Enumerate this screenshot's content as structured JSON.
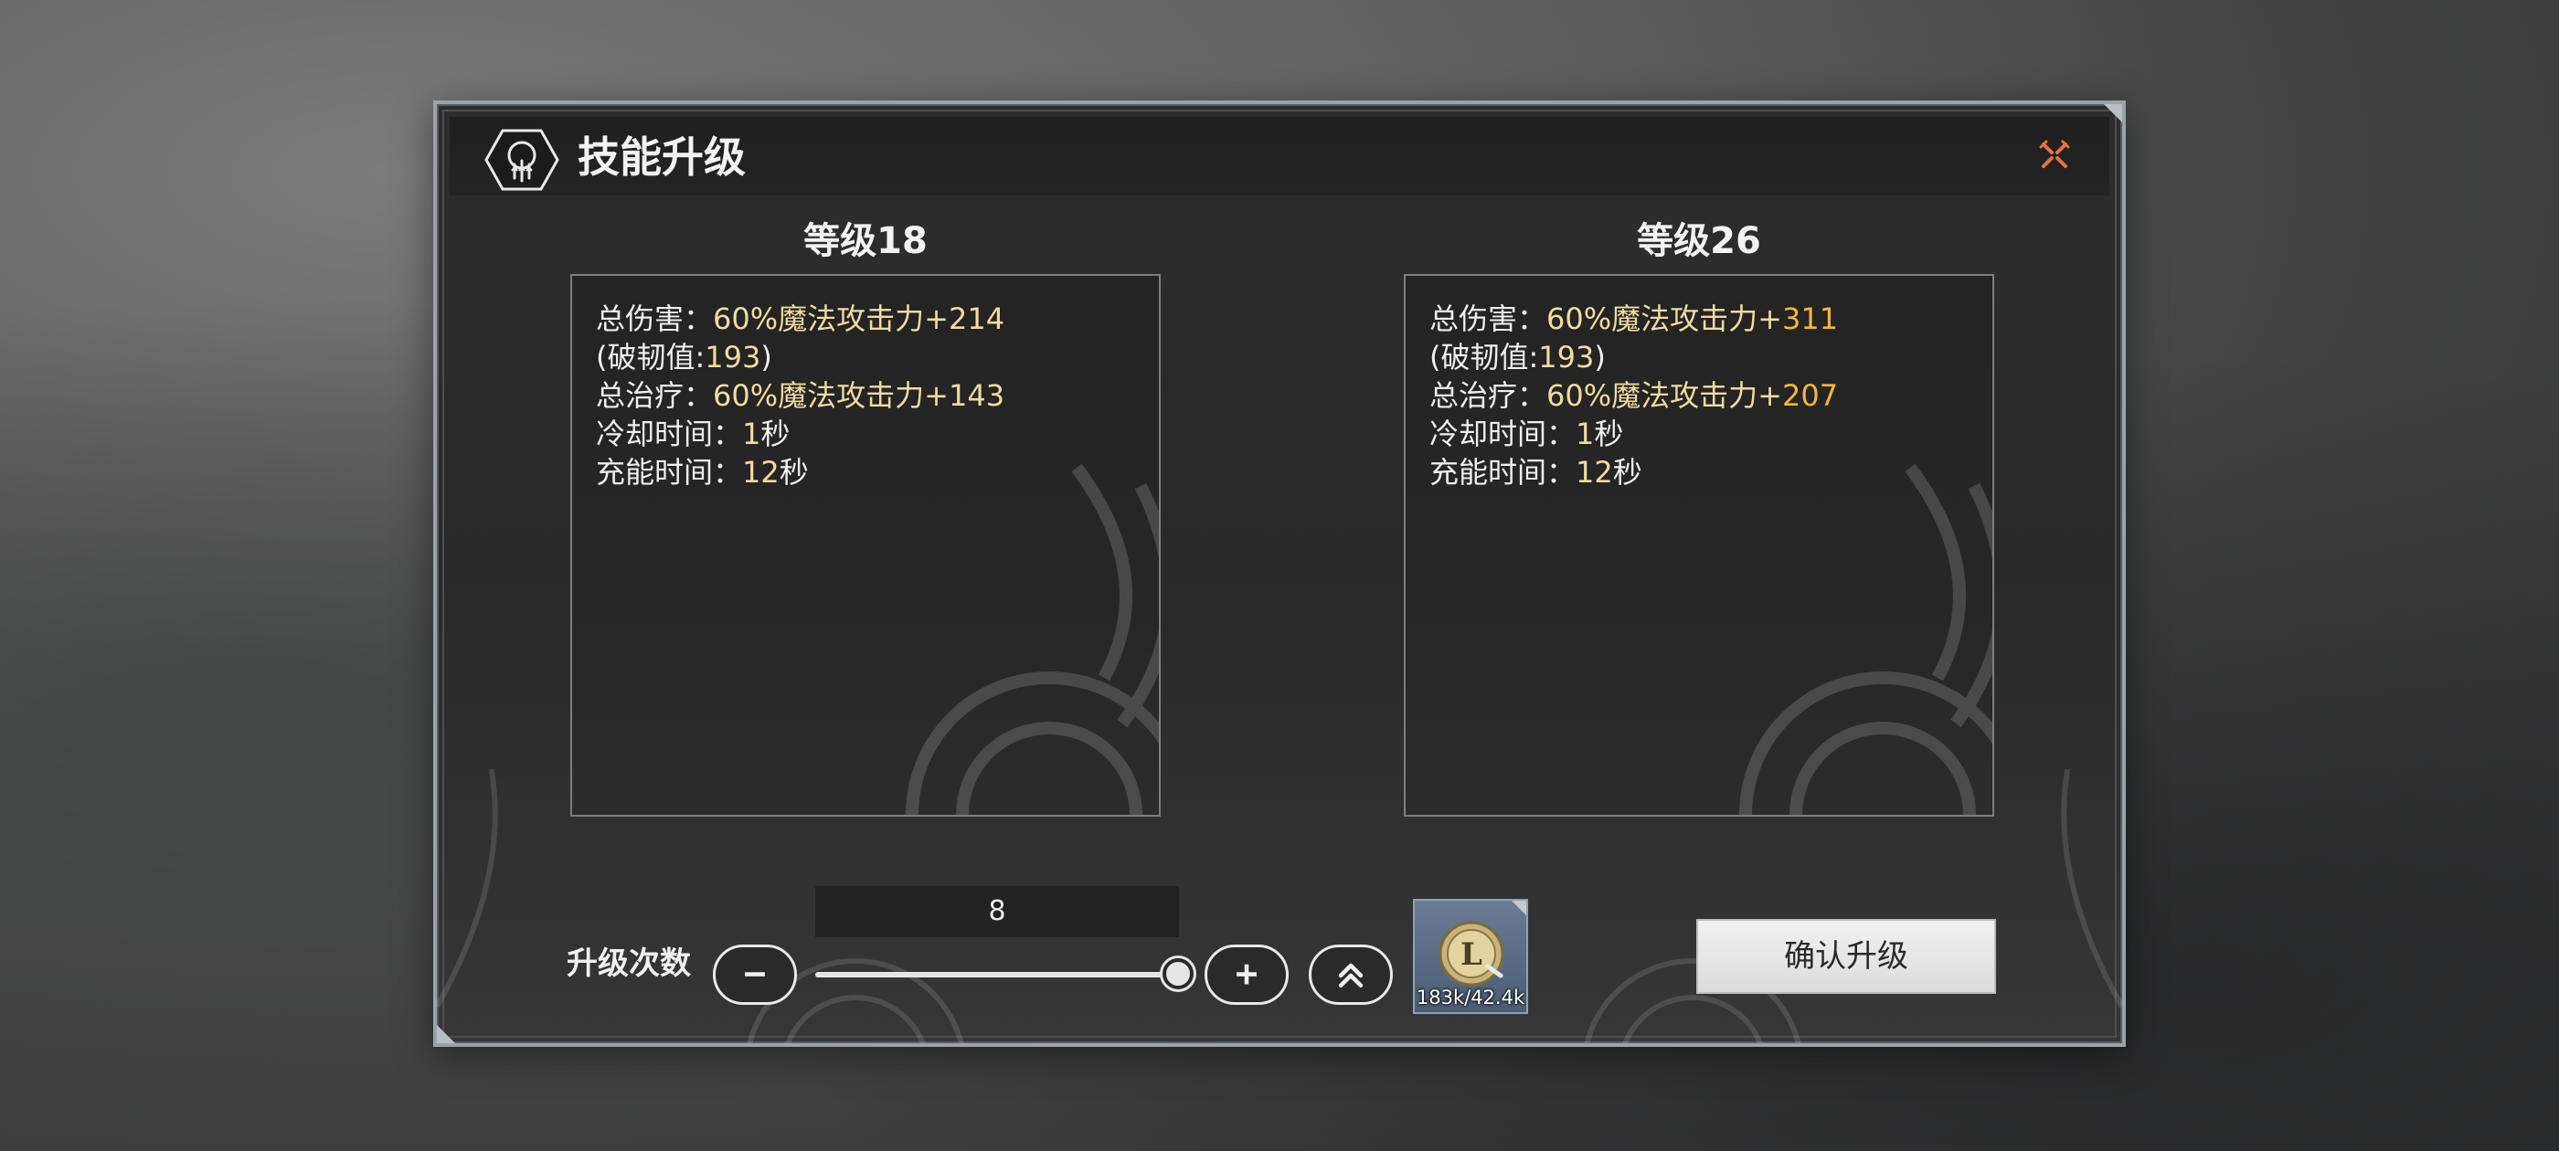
{
  "dialog": {
    "title": "技能升级",
    "title_icon": "skill-emblem-icon",
    "close_icon": "close-x-icon"
  },
  "current": {
    "level_title": "等级18",
    "stats": [
      {
        "label": "总伤害：",
        "value": "60%魔法攻击力+",
        "number": "214"
      },
      {
        "label": "(破韧值:",
        "value": "193",
        "suffix": ")"
      },
      {
        "label": "总治疗：",
        "value": "60%魔法攻击力+",
        "number": "143"
      },
      {
        "label": "冷却时间：",
        "value": "1",
        "suffix": "秒"
      },
      {
        "label": "充能时间：",
        "value": "12",
        "suffix": "秒"
      }
    ]
  },
  "next": {
    "level_title": "等级26",
    "stats": [
      {
        "label": "总伤害：",
        "value": "60%魔法攻击力+",
        "number": "311"
      },
      {
        "label": "(破韧值:",
        "value": "193",
        "suffix": ")"
      },
      {
        "label": "总治疗：",
        "value": "60%魔法攻击力+",
        "number": "207"
      },
      {
        "label": "冷却时间：",
        "value": "1",
        "suffix": "秒"
      },
      {
        "label": "充能时间：",
        "value": "12",
        "suffix": "秒"
      }
    ]
  },
  "upgrade": {
    "label": "升级次数",
    "count": "8",
    "slider_fraction": 1.0,
    "confirm_label": "确认升级"
  },
  "cost_item": {
    "icon": "gold-coin-icon",
    "quantity": "183k/42.4k"
  },
  "colors": {
    "value_text": "#f0dca0",
    "increased_value": "#f3b83a",
    "close_accent": "#e8743a",
    "item_slot": "#5a6c84"
  }
}
